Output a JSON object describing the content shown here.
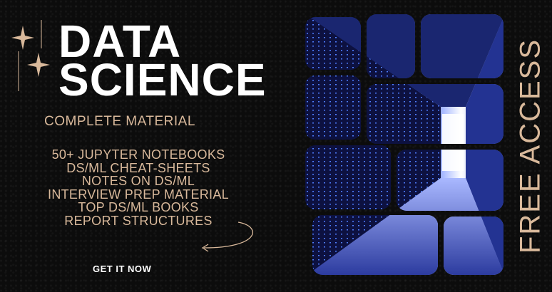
{
  "headline": {
    "line1": "DATA",
    "line2": "SCIENCE"
  },
  "subtitle": "COMPLETE MATERIAL",
  "features": [
    "50+ JUPYTER NOTEBOOKS",
    "DS/ML CHEAT-SHEETS",
    "NOTES ON DS/ML",
    "INTERVIEW PREP MATERIAL",
    "TOP DS/ML BOOKS",
    "REPORT STRUCTURES"
  ],
  "cta_label": "GET IT NOW",
  "side_text": "FREE ACCESS",
  "colors": {
    "accent": "#d9b99b",
    "text": "#ffffff",
    "background": "#0c0c0c",
    "server_blue": "#3b5bd6"
  },
  "icons": [
    "sparkle-icon",
    "curved-arrow-icon"
  ]
}
